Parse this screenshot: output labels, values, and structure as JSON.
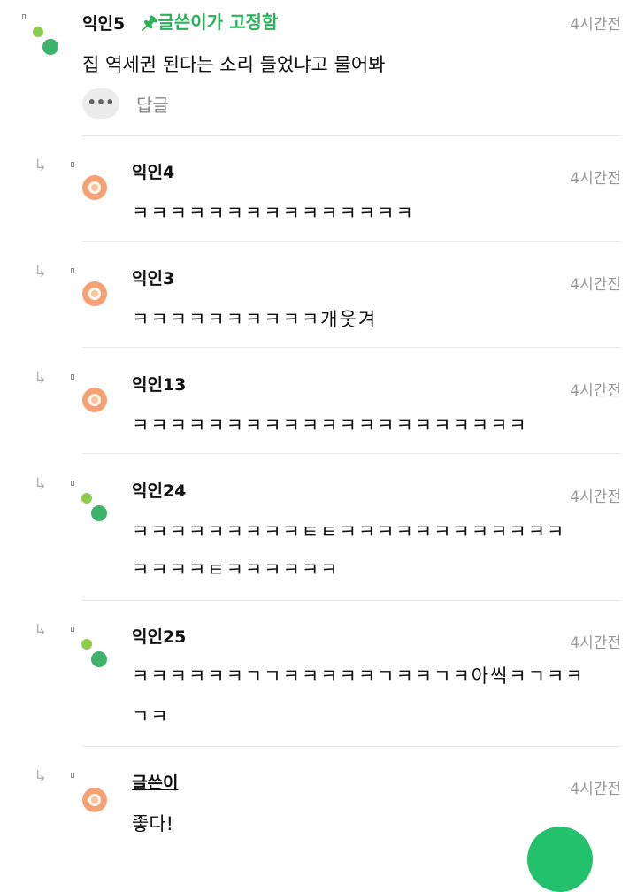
{
  "top_comment": {
    "author": "익인5",
    "pin_badge": "🖈글쓴이가 고정함",
    "time": "4시간전",
    "text": "집 역세권 된다는 소리 들었냐고 물어봐",
    "more_label": "•••",
    "reply_label": "답글"
  },
  "replies": [
    {
      "author": "익인4",
      "time": "4시간전",
      "line1": "ㅋㅋㅋㅋㅋㅋㅋㅋㅋㅋㅋㅋㅋㅋㅋ",
      "line2": ""
    },
    {
      "author": "익인3",
      "time": "4시간전",
      "line1": "ㅋㅋㅋㅋㅋㅋㅋㅋㅋㅋ개웃겨",
      "line2": ""
    },
    {
      "author": "익인13",
      "time": "4시간전",
      "line1": "ㅋㅋㅋㅋㅋㅋㅋㅋㅋㅋㅋㅋㅋㅋㅋㅋㅋㅋㅋㅋㅋ",
      "line2": ""
    },
    {
      "author": "익인24",
      "time": "4시간전",
      "line1": "ㅋㅋㅋㅋㅋㅋㅋㅋㅋㅌㅌㅋㅋㅋㅋㅋㅋㅋㅋㅋㅋㅋㅋ",
      "line2": "ㅋㅋㅋㅋㅌㅋㅋㅋㅋㅋㅋ"
    },
    {
      "author": "익인25",
      "time": "4시간전",
      "line1": "ㅋㅋㅋㅋㅋㅋㄱㄱㅋㅋㅋㅋㅋㄱㅋㅋㄱㅋ아씩ㅋㄱㅋㅋ",
      "line2": "ㄱㅋ"
    },
    {
      "author": "글쓴이",
      "time": "4시간전",
      "line1": "좋다!",
      "line2": ""
    }
  ],
  "colors": {
    "accent_green": "#2ab15a",
    "avatar_orange": "#f3a275"
  },
  "icons": {
    "reply_arrow": "reply-arrow-icon",
    "more": "more-dots-icon"
  }
}
